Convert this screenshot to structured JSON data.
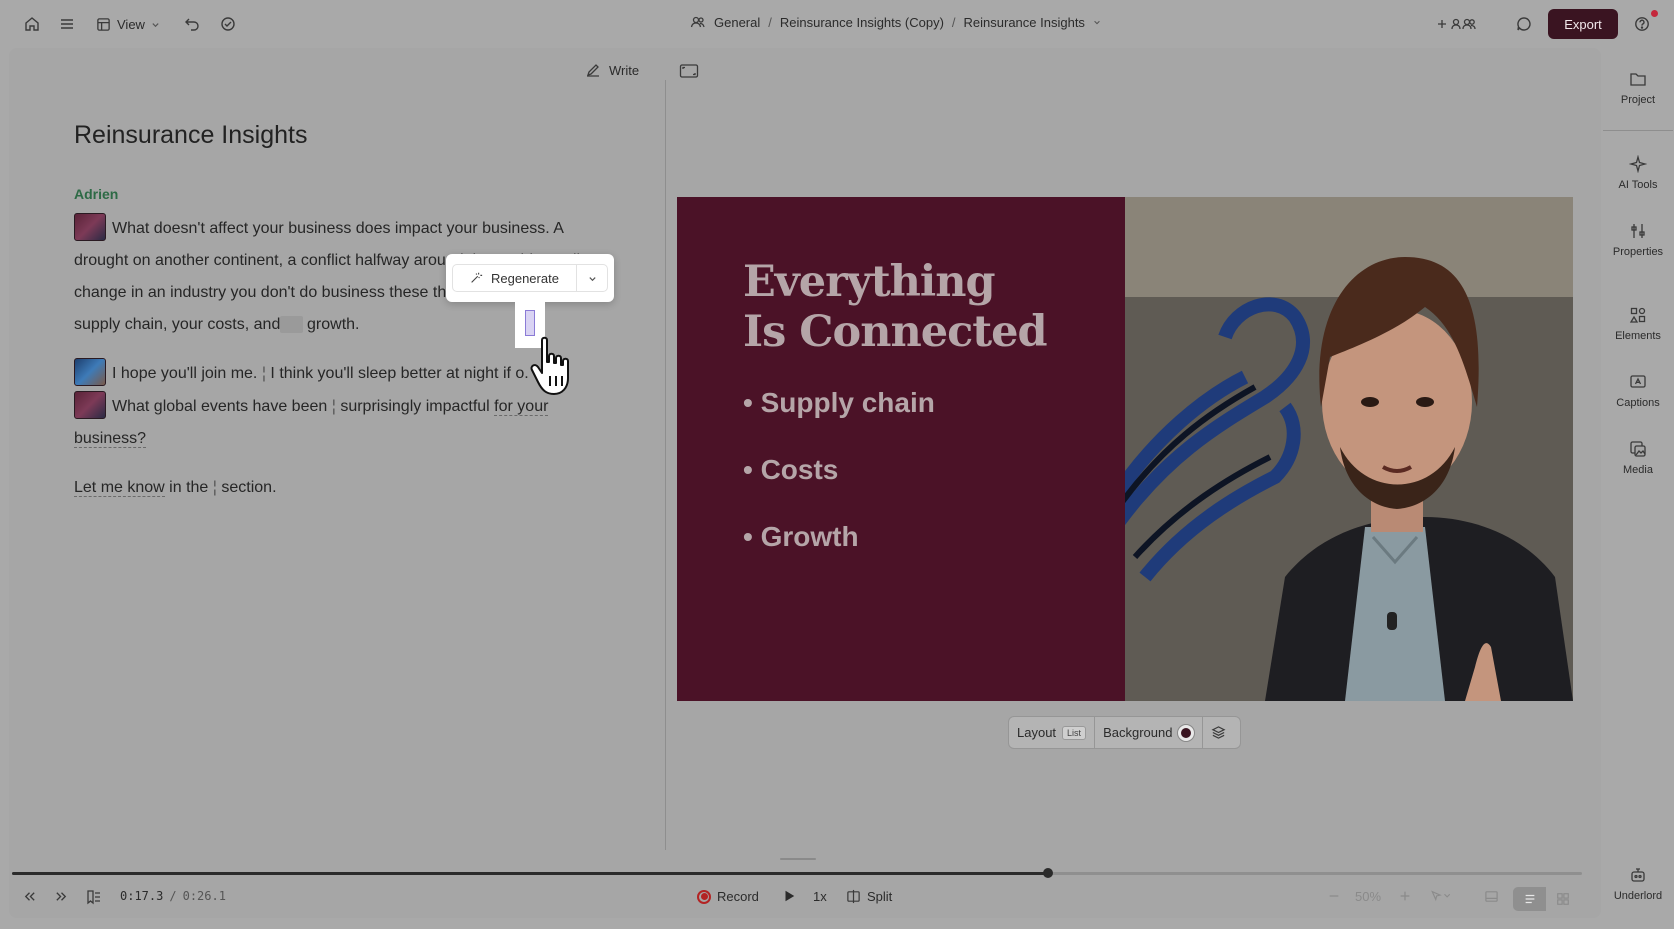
{
  "topbar": {
    "view_label": "View",
    "breadcrumb": [
      "General",
      "Reinsurance Insights (Copy)",
      "Reinsurance Insights"
    ],
    "breadcrumb_sep": "/",
    "export_label": "Export"
  },
  "editor": {
    "write_label": "Write",
    "title": "Reinsurance Insights",
    "speaker": "Adrien",
    "p1_a": "What doesn't affect your business does impact your business. A drought on another continent, a conflict halfway around the world, a policy change in an industry you don't do business",
    "p1_b": "these things can",
    "p1_c": "impact your supply chain, your costs, and",
    "p1_d": "growth.",
    "p2_a": "I hope you'll join me.",
    "p2_b": "I think you'll sleep better at night if",
    "p2_c": "o.",
    "p3_a": "What global events have been",
    "p3_b": "surprisingly impactful",
    "p3_c": "for your business?",
    "p4_a": "Let me know",
    "p4_b": "in the",
    "p4_c": "section.",
    "bar_char": "¦",
    "regenerate_label": "Regenerate"
  },
  "slide": {
    "title_line1": "Everything",
    "title_line2": "Is Connected",
    "bullets": [
      "• Supply chain",
      "• Costs",
      "• Growth"
    ]
  },
  "layout_bar": {
    "layout_label": "Layout",
    "layout_badge": "List",
    "background_label": "Background"
  },
  "rail": {
    "items": [
      "Project",
      "AI Tools",
      "Properties",
      "Elements",
      "Captions",
      "Media"
    ],
    "bottom_item": "Underlord"
  },
  "playback": {
    "current_time": "0:17.3",
    "separator": "/",
    "total_time": "0:26.1",
    "progress": 0.66,
    "record_label": "Record",
    "speed_label": "1x",
    "split_label": "Split",
    "zoom_label": "50%"
  },
  "colors": {
    "accent": "#3a1421",
    "slide_bg": "#4b1227",
    "speaker": "#2d6a45",
    "record": "#b32323"
  }
}
